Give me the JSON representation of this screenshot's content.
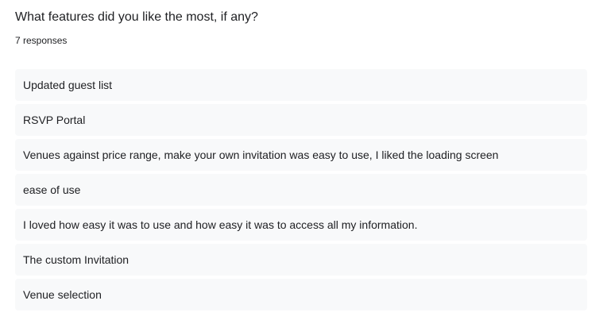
{
  "question": {
    "title": "What features did you like the most, if any?",
    "response_count": "7 responses"
  },
  "responses": [
    "Updated guest list",
    "RSVP Portal",
    "Venues against price range, make your own invitation was easy to use, I liked the loading screen",
    "ease of use",
    "I loved how easy it was to use and how easy it was to access all my information.",
    "The custom Invitation",
    "Venue selection"
  ],
  "colors": {
    "text": "#202124",
    "response_background": "#f8f9fa",
    "page_background": "#ffffff"
  }
}
